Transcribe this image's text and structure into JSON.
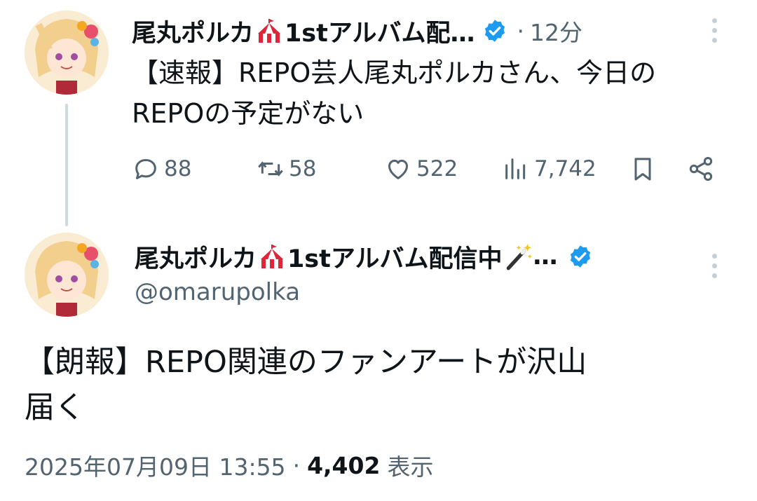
{
  "reply_tweet": {
    "display_name": "尾丸ポルカ",
    "display_name_suffix": "1stアルバム配…",
    "time_sep": "·",
    "time": "12分",
    "text_line1": "【速報】REPO芸人尾丸ポルカさん、今日の",
    "text_line2": "REPOの予定がない",
    "stats": {
      "replies": "88",
      "retweets": "58",
      "likes": "522",
      "views": "7,742"
    }
  },
  "main_tweet": {
    "display_name": "尾丸ポルカ",
    "display_name_suffix": "1stアルバム配信中",
    "ellipsis": "…",
    "handle": "@omarupolka",
    "text_line1": "【朗報】REPO関連のファンアートが沢山",
    "text_line2": "届く",
    "timestamp": "2025年07月09日 13:55",
    "sep": "·",
    "views_count": "4,402",
    "views_label": "表示"
  },
  "colors": {
    "verified": "#1d9bf0",
    "text": "#0f1419",
    "secondary": "#536471",
    "thread_line": "#cfd9de"
  },
  "icons": [
    "circus-tent-icon",
    "verified-badge-icon",
    "magic-wand-icon",
    "more-icon",
    "reply-icon",
    "retweet-icon",
    "like-icon",
    "views-icon",
    "bookmark-icon",
    "share-icon"
  ]
}
